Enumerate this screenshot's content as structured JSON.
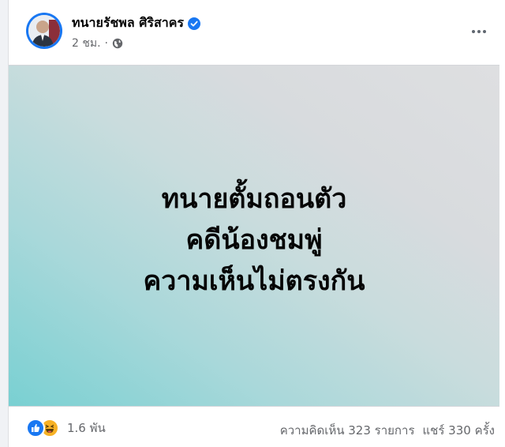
{
  "post": {
    "author": "ทนายรัชพล ศิริสาคร",
    "verified": true,
    "time": "2 ชม.",
    "privacy_icon": "globe-icon",
    "more_icon": "more-options-icon"
  },
  "media": {
    "lines": [
      "ทนายตั้มถอนตัว",
      "คดีน้องชมพู่",
      "ความเห็นไม่ตรงกัน"
    ]
  },
  "footer": {
    "reactions": [
      "like",
      "haha"
    ],
    "reaction_count": "1.6 พัน",
    "comments": "ความคิดเห็น 323 รายการ",
    "shares": "แชร์ 330 ครั้ง"
  },
  "colors": {
    "brand": "#1877f2",
    "text": "#050505",
    "muted": "#65676b"
  }
}
